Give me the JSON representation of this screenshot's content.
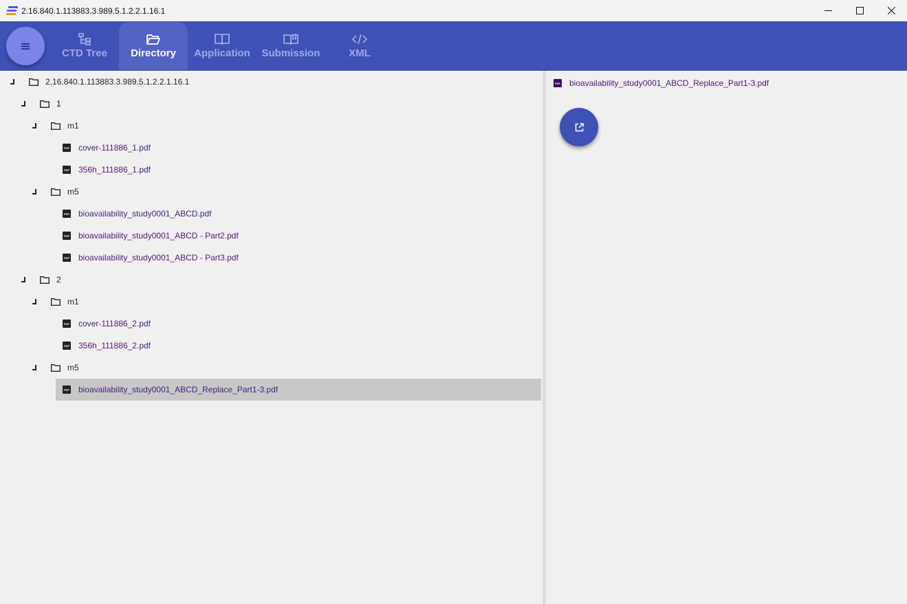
{
  "window": {
    "title": "2.16.840.1.113883.3.989.5.1.2.2.1.16.1",
    "controls": [
      "minimize-icon",
      "maximize-icon",
      "close-icon"
    ]
  },
  "toolbar": {
    "menu_icon": "hamburger-menu-icon",
    "tabs": [
      {
        "label": "CTD Tree",
        "icon": "tree-icon",
        "active": false
      },
      {
        "label": "Directory",
        "icon": "folder-open-icon",
        "active": true
      },
      {
        "label": "Application",
        "icon": "book-icon",
        "active": false
      },
      {
        "label": "Submission",
        "icon": "book-open-icon",
        "active": false
      },
      {
        "label": "XML",
        "icon": "code-icon",
        "active": false
      }
    ]
  },
  "tree": {
    "root": "2.16.840.1.113883.3.989.5.1.2.2.1.16.1",
    "nodes": [
      {
        "label": "1",
        "type": "folder"
      },
      {
        "label": "m1",
        "type": "folder"
      },
      {
        "label": "cover-111886_1.pdf",
        "type": "file"
      },
      {
        "label": "356h_111886_1.pdf",
        "type": "file"
      },
      {
        "label": "m5",
        "type": "folder"
      },
      {
        "label": "bioavailability_study0001_ABCD.pdf",
        "type": "file"
      },
      {
        "label": "bioavailability_study0001_ABCD - Part2.pdf",
        "type": "file"
      },
      {
        "label": "bioavailability_study0001_ABCD - Part3.pdf",
        "type": "file"
      },
      {
        "label": "2",
        "type": "folder"
      },
      {
        "label": "m1",
        "type": "folder"
      },
      {
        "label": "cover-111886_2.pdf",
        "type": "file"
      },
      {
        "label": "356h_111886_2.pdf",
        "type": "file"
      },
      {
        "label": "m5",
        "type": "folder"
      },
      {
        "label": "bioavailability_study0001_ABCD_Replace_Part1-3.pdf",
        "type": "file",
        "selected": true
      }
    ]
  },
  "detail": {
    "file_label": "bioavailability_study0001_ABCD_Replace_Part1-3.pdf",
    "file_icon_text": "PDF",
    "open_button_icon": "open-external-icon"
  },
  "pdf_icon_text": "PDF",
  "colors": {
    "toolbar": "#3f51b5",
    "active_tab": "#5462c4",
    "menu_fab": "#7986e8",
    "selection": "#c8c8c8",
    "file_link": "#4a1a7a"
  }
}
